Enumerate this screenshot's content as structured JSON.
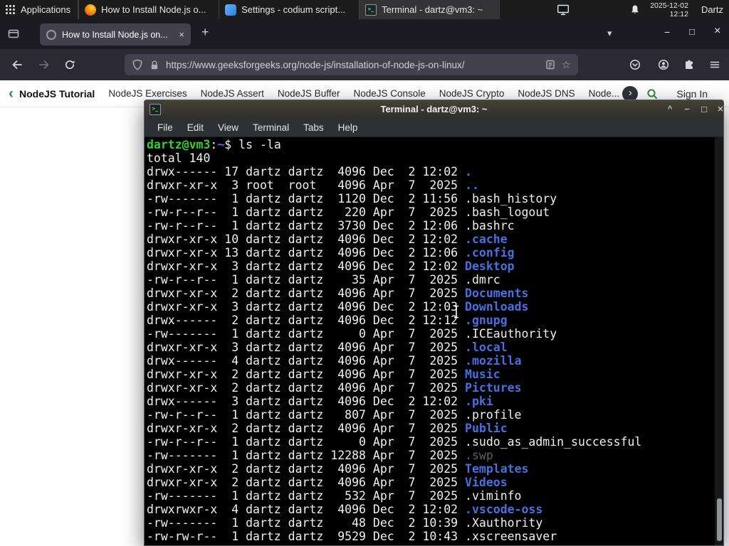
{
  "colors": {
    "gfg_green": "#2f8d46",
    "terminal_prompt_green": "#2fd32f",
    "terminal_dir_blue": "#4671e0",
    "terminal_dim_gray": "#5f5f5f",
    "firefox_dark": "#1c1b22",
    "tab_gray": "#42414d",
    "panel_dark": "#1c1c1c"
  },
  "panel": {
    "applications_label": "Applications",
    "taskbar": [
      {
        "title": "How to Install Node.js o...",
        "icon": "firefox",
        "active": false
      },
      {
        "title": "Settings - codium script...",
        "icon": "codium",
        "active": false
      },
      {
        "title": "Terminal - dartz@vm3: ~",
        "icon": "terminal",
        "active": true
      }
    ],
    "clock_date": "2025-12-02",
    "clock_time": "12:12",
    "user": "Dartz"
  },
  "browser": {
    "tab_title": "How to Install Node.js on...",
    "url": "https://www.geeksforgeeks.org/node-js/installation-of-node-js-on-linux/"
  },
  "site_nav": {
    "links": [
      "NodeJS Tutorial",
      "NodeJS Exercises",
      "NodeJS Assert",
      "NodeJS Buffer",
      "NodeJS Console",
      "NodeJS Crypto",
      "NodeJS DNS",
      "Node..."
    ],
    "sign_in_label": "Sign In"
  },
  "terminal": {
    "window_title": "Terminal - dartz@vm3: ~",
    "menu": [
      "File",
      "Edit",
      "View",
      "Terminal",
      "Tabs",
      "Help"
    ],
    "lines": [
      [
        [
          "g",
          "dartz@vm3"
        ],
        [
          "t",
          ":"
        ],
        [
          "b",
          "~"
        ],
        [
          "t",
          "$ ls -la"
        ]
      ],
      [
        [
          "t",
          "total 140"
        ]
      ],
      [
        [
          "t",
          "drwx------ 17 dartz dartz  4096 Dec  2 12:02 "
        ],
        [
          "b",
          "."
        ]
      ],
      [
        [
          "t",
          "drwxr-xr-x  3 root  root   4096 Apr  7  2025 "
        ],
        [
          "b",
          ".."
        ]
      ],
      [
        [
          "t",
          "-rw-------  1 dartz dartz  1120 Dec  2 11:56 .bash_history"
        ]
      ],
      [
        [
          "t",
          "-rw-r--r--  1 dartz dartz   220 Apr  7  2025 .bash_logout"
        ]
      ],
      [
        [
          "t",
          "-rw-r--r--  1 dartz dartz  3730 Dec  2 12:06 .bashrc"
        ]
      ],
      [
        [
          "t",
          "drwxr-xr-x 10 dartz dartz  4096 Dec  2 12:02 "
        ],
        [
          "b",
          ".cache"
        ]
      ],
      [
        [
          "t",
          "drwxr-xr-x 13 dartz dartz  4096 Dec  2 12:06 "
        ],
        [
          "b",
          ".config"
        ]
      ],
      [
        [
          "t",
          "drwxr-xr-x  3 dartz dartz  4096 Dec  2 12:02 "
        ],
        [
          "b",
          "Desktop"
        ]
      ],
      [
        [
          "t",
          "-rw-r--r--  1 dartz dartz    35 Apr  7  2025 .dmrc"
        ]
      ],
      [
        [
          "t",
          "drwxr-xr-x  2 dartz dartz  4096 Apr  7  2025 "
        ],
        [
          "b",
          "Documents"
        ]
      ],
      [
        [
          "t",
          "drwxr-xr-x  3 dartz dartz  4096 Dec  2 12:03 "
        ],
        [
          "b",
          "Downloads"
        ]
      ],
      [
        [
          "t",
          "drwx------  2 dartz dartz  4096 Dec  2 12:12 "
        ],
        [
          "b",
          ".gnupg"
        ]
      ],
      [
        [
          "t",
          "-rw-------  1 dartz dartz     0 Apr  7  2025 .ICEauthority"
        ]
      ],
      [
        [
          "t",
          "drwxr-xr-x  3 dartz dartz  4096 Apr  7  2025 "
        ],
        [
          "b",
          ".local"
        ]
      ],
      [
        [
          "t",
          "drwx------  4 dartz dartz  4096 Apr  7  2025 "
        ],
        [
          "b",
          ".mozilla"
        ]
      ],
      [
        [
          "t",
          "drwxr-xr-x  2 dartz dartz  4096 Apr  7  2025 "
        ],
        [
          "b",
          "Music"
        ]
      ],
      [
        [
          "t",
          "drwxr-xr-x  2 dartz dartz  4096 Apr  7  2025 "
        ],
        [
          "b",
          "Pictures"
        ]
      ],
      [
        [
          "t",
          "drwx------  3 dartz dartz  4096 Dec  2 12:02 "
        ],
        [
          "b",
          ".pki"
        ]
      ],
      [
        [
          "t",
          "-rw-r--r--  1 dartz dartz   807 Apr  7  2025 .profile"
        ]
      ],
      [
        [
          "t",
          "drwxr-xr-x  2 dartz dartz  4096 Apr  7  2025 "
        ],
        [
          "b",
          "Public"
        ]
      ],
      [
        [
          "t",
          "-rw-r--r--  1 dartz dartz     0 Apr  7  2025 .sudo_as_admin_successful"
        ]
      ],
      [
        [
          "t",
          "-rw-------  1 dartz dartz 12288 Apr  7  2025 "
        ],
        [
          "dm",
          ".swp"
        ]
      ],
      [
        [
          "t",
          "drwxr-xr-x  2 dartz dartz  4096 Apr  7  2025 "
        ],
        [
          "b",
          "Templates"
        ]
      ],
      [
        [
          "t",
          "drwxr-xr-x  2 dartz dartz  4096 Apr  7  2025 "
        ],
        [
          "b",
          "Videos"
        ]
      ],
      [
        [
          "t",
          "-rw-------  1 dartz dartz   532 Apr  7  2025 .viminfo"
        ]
      ],
      [
        [
          "t",
          "drwxrwxr-x  4 dartz dartz  4096 Dec  2 12:02 "
        ],
        [
          "b",
          ".vscode-oss"
        ]
      ],
      [
        [
          "t",
          "-rw-------  1 dartz dartz    48 Dec  2 10:39 .Xauthority"
        ]
      ],
      [
        [
          "t",
          "-rw-rw-r--  1 dartz dartz  9529 Dec  2 10:43 .xscreensaver"
        ]
      ]
    ]
  },
  "icons": {
    "close": "×",
    "plus": "+",
    "caret_down": "▾",
    "minimize": "−",
    "maximize": "□",
    "shade": "^",
    "star": "☆",
    "chevron_left": "‹",
    "chevron_right": "›",
    "terminal_glyph": ">_"
  }
}
